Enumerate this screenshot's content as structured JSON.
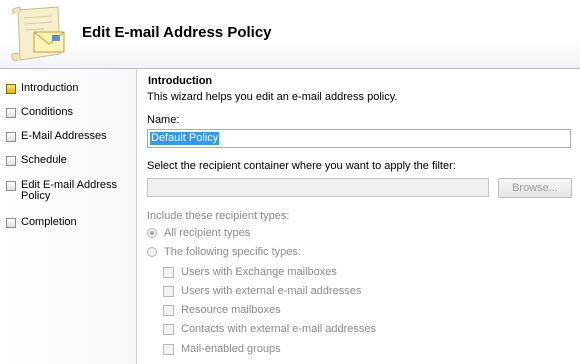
{
  "header": {
    "title": "Edit E-mail Address Policy"
  },
  "nav": {
    "items": [
      {
        "label": "Introduction"
      },
      {
        "label": "Conditions"
      },
      {
        "label": "E-Mail Addresses"
      },
      {
        "label": "Schedule"
      },
      {
        "label": "Edit E-mail Address Policy"
      },
      {
        "label": "Completion"
      }
    ]
  },
  "main": {
    "section_title": "Introduction",
    "description": "This wizard helps you edit an e-mail address policy.",
    "name_label": "Name:",
    "name_value": "Default Policy",
    "container_label": "Select the recipient container where you want to apply the filter:",
    "container_value": "",
    "browse_label": "Browse...",
    "types_label": "Include these recipient types:",
    "radio_all": "All recipient types",
    "radio_specific": "The following specific types:",
    "checkboxes": [
      {
        "label": "Users with Exchange mailboxes"
      },
      {
        "label": "Users with external e-mail addresses"
      },
      {
        "label": "Resource mailboxes"
      },
      {
        "label": "Contacts with external e-mail addresses"
      },
      {
        "label": "Mail-enabled groups"
      }
    ]
  }
}
